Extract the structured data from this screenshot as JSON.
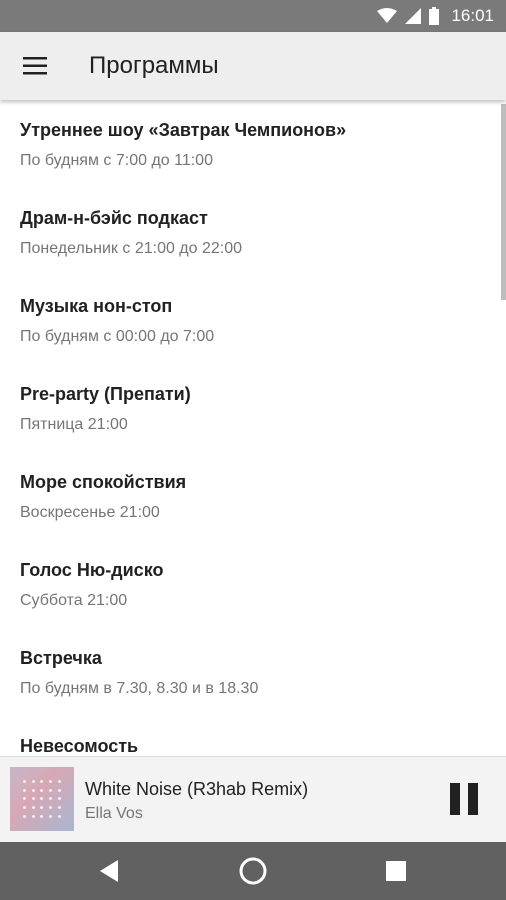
{
  "status_bar": {
    "time": "16:01",
    "icons": [
      "wifi-icon",
      "signal-icon",
      "battery-icon"
    ]
  },
  "app_bar": {
    "menu_icon": "hamburger-menu-icon",
    "title": "Программы"
  },
  "programs": [
    {
      "title": "Утреннее шоу «Завтрак Чемпионов»",
      "schedule": "По будням с 7:00 до 11:00"
    },
    {
      "title": "Драм-н-бэйс подкаст",
      "schedule": "Понедельник с 21:00 до 22:00"
    },
    {
      "title": "Музыка нон-стоп",
      "schedule": "По будням с 00:00 до 7:00"
    },
    {
      "title": "Pre-party (Препати)",
      "schedule": "Пятница 21:00"
    },
    {
      "title": "Море спокойствия",
      "schedule": "Воскресенье 21:00"
    },
    {
      "title": "Голос Ню-диско",
      "schedule": "Суббота 21:00"
    },
    {
      "title": "Встречка",
      "schedule": "По будням в 7.30, 8.30 и в 18.30"
    },
    {
      "title": "Невесомость",
      "schedule": ""
    }
  ],
  "player": {
    "track_title": "White Noise (R3hab Remix)",
    "artist": "Ella Vos",
    "state_icon": "pause-icon"
  },
  "nav_bar": {
    "icons": [
      "back-icon",
      "home-icon",
      "recents-icon"
    ]
  },
  "colors": {
    "app_bar_bg": "#eeeeee",
    "status_bar_bg": "#7a7a7a",
    "nav_bar_bg": "#616161",
    "primary_text": "#212121",
    "secondary_text": "#757575"
  }
}
